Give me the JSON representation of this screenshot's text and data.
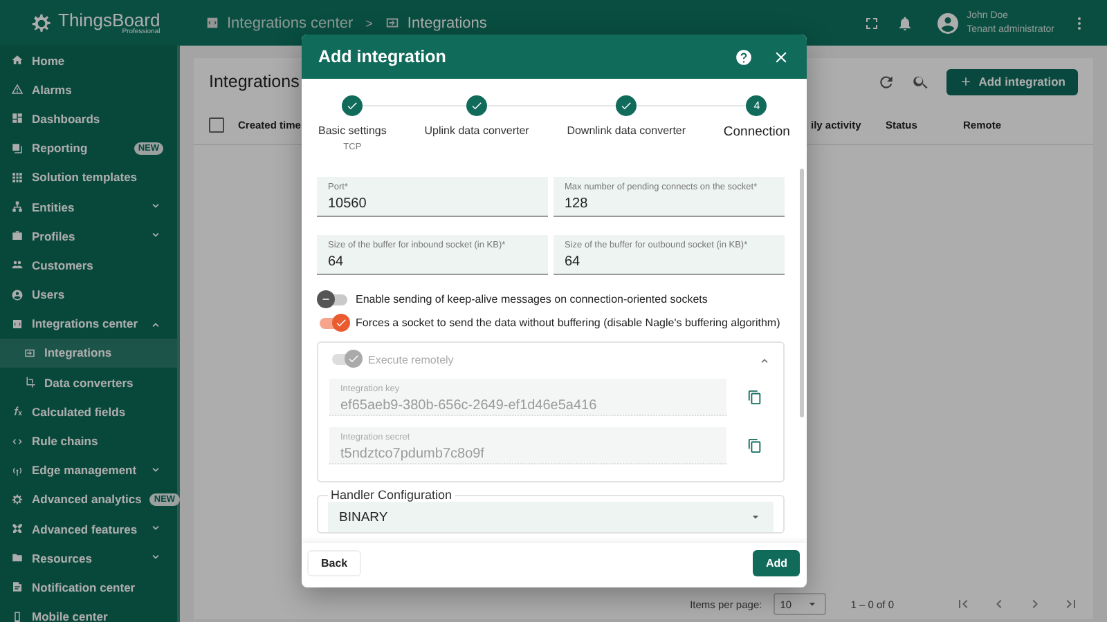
{
  "top_bar": {
    "logo": {
      "name": "ThingsBoard",
      "edition": "Professional"
    },
    "breadcrumbs": [
      {
        "label": "Integrations center"
      },
      {
        "label": "Integrations"
      }
    ],
    "separator": ">",
    "user": {
      "name": "John Doe",
      "role": "Tenant administrator"
    }
  },
  "sidebar": {
    "items": [
      {
        "label": "Home",
        "selected": false
      },
      {
        "label": "Alarms",
        "selected": false
      },
      {
        "label": "Dashboards",
        "selected": false
      },
      {
        "label": "Reporting",
        "badge": "NEW",
        "selected": false
      },
      {
        "label": "Solution templates",
        "selected": false
      },
      {
        "label": "Entities",
        "expanded": false,
        "selected": false
      },
      {
        "label": "Profiles",
        "expanded": false,
        "selected": false
      },
      {
        "label": "Customers",
        "selected": false
      },
      {
        "label": "Users",
        "selected": false
      },
      {
        "label": "Integrations center",
        "expanded": true,
        "selected": false,
        "children": [
          {
            "label": "Integrations",
            "selected": true
          },
          {
            "label": "Data converters",
            "selected": false
          }
        ]
      },
      {
        "label": "Calculated fields",
        "selected": false
      },
      {
        "label": "Rule chains",
        "selected": false
      },
      {
        "label": "Edge management",
        "expanded": false,
        "selected": false
      },
      {
        "label": "Advanced analytics",
        "badge": "NEW",
        "selected": false
      },
      {
        "label": "Advanced features",
        "expanded": false,
        "selected": false
      },
      {
        "label": "Resources",
        "expanded": false,
        "selected": false
      },
      {
        "label": "Notification center",
        "selected": false
      },
      {
        "label": "Mobile center",
        "selected": false
      }
    ]
  },
  "page": {
    "title": "Integrations",
    "add_button": "Add integration",
    "select_all_checked": false,
    "columns": [
      "Created time",
      "ily activity",
      "Status",
      "Remote"
    ],
    "paginator": {
      "label": "Items per page:",
      "page_size": "10",
      "range": "1 – 0 of 0"
    }
  },
  "dialog": {
    "title": "Add integration",
    "steps": [
      {
        "label": "Basic settings",
        "sublabel": "TCP",
        "done": true,
        "selected": false
      },
      {
        "label": "Uplink data converter",
        "done": true,
        "selected": false
      },
      {
        "label": "Downlink data converter",
        "done": true,
        "selected": false
      },
      {
        "label": "Connection",
        "number": "4",
        "done": false,
        "selected": true
      }
    ],
    "fields": [
      {
        "label": "Port*",
        "value": "10560"
      },
      {
        "label": "Max number of pending connects on the socket*",
        "value": "128"
      },
      {
        "label": "Size of the buffer for inbound socket (in KB)*",
        "value": "64"
      },
      {
        "label": "Size of the buffer for outbound socket (in KB)*",
        "value": "64"
      }
    ],
    "toggles": [
      {
        "label": "Enable sending of keep-alive messages on connection-oriented sockets",
        "on": false
      },
      {
        "label": "Forces a socket to send the data without buffering (disable Nagle's buffering algorithm)",
        "on": true
      }
    ],
    "remote_panel": {
      "label": "Execute remotely",
      "on": true,
      "disabled": true,
      "expanded": true,
      "fields": [
        {
          "label": "Integration key",
          "value": "ef65aeb9-380b-656c-2649-ef1d46e5a416"
        },
        {
          "label": "Integration secret",
          "value": "t5ndztco7pdumb7c8o9f"
        }
      ]
    },
    "handler": {
      "legend": "Handler Configuration",
      "value": "BINARY"
    },
    "buttons": {
      "back": "Back",
      "add": "Add"
    }
  }
}
